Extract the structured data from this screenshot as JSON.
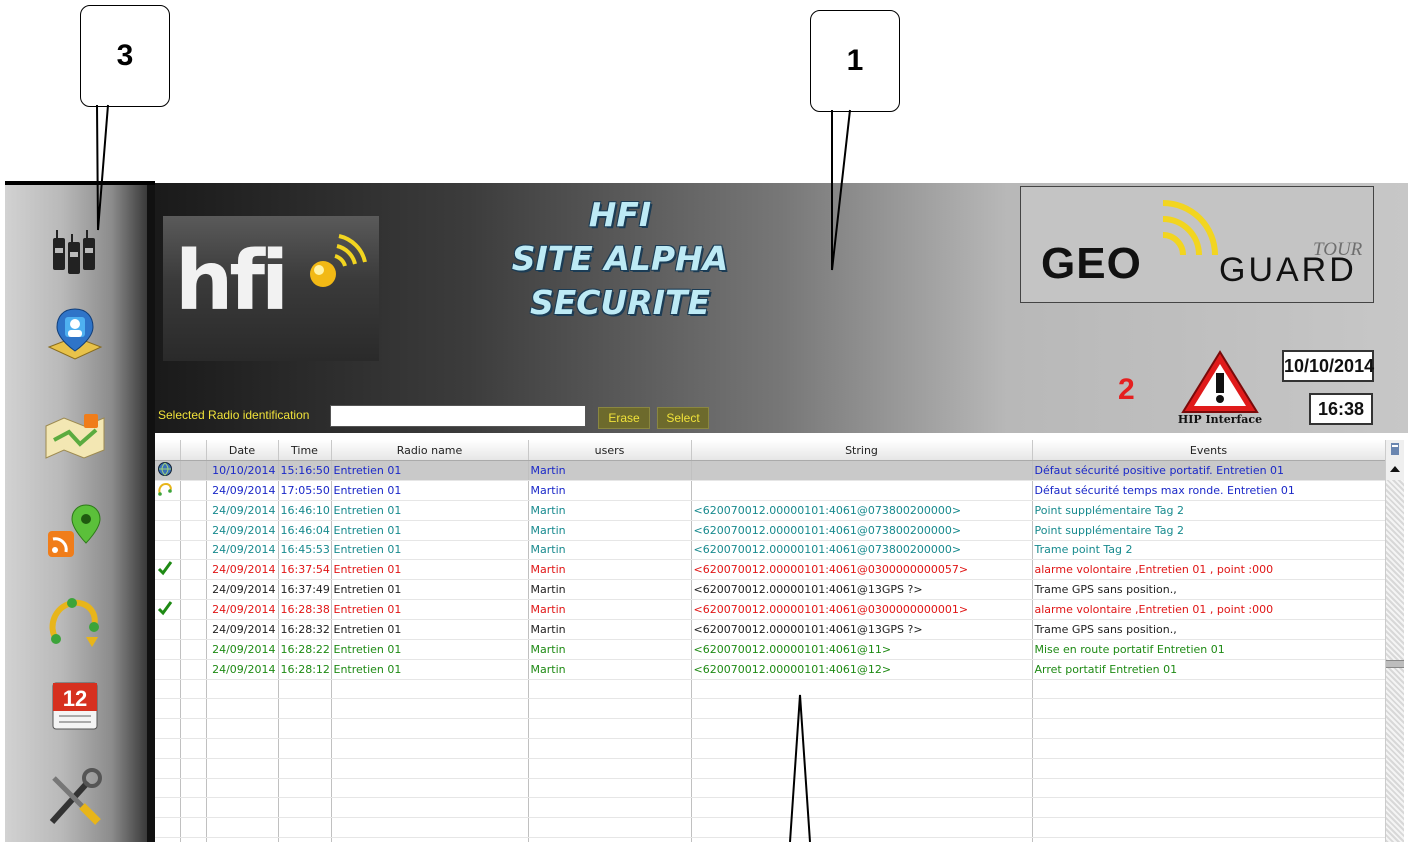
{
  "callouts": {
    "c1": "1",
    "c2": "2",
    "c3": "3"
  },
  "header": {
    "title_lines": [
      "HFI",
      "SITE ALPHA",
      "SECURITE"
    ],
    "hfi_logo_text": "hfi",
    "geoguard": {
      "geo": "GEO",
      "guard": "GUARD",
      "tour": "TOUR"
    },
    "selected_radio_label": "Selected Radio identification",
    "selected_radio_value": "",
    "erase_label": "Erase",
    "select_label": "Select",
    "hip_label": "HIP Interface",
    "date": "10/10/2014",
    "time": "16:38"
  },
  "sidebar": {
    "items": [
      {
        "icon": "radios-icon"
      },
      {
        "icon": "user-map-icon"
      },
      {
        "icon": "map-feed-icon"
      },
      {
        "icon": "rss-pin-icon"
      },
      {
        "icon": "route-icon"
      },
      {
        "icon": "calendar-icon",
        "text": "12"
      },
      {
        "icon": "tools-icon"
      }
    ]
  },
  "table": {
    "columns": [
      "",
      "",
      "Date",
      "Time",
      "Radio name",
      "users",
      "String",
      "Events"
    ],
    "rows": [
      {
        "icon": "globe",
        "date": "10/10/2014",
        "time": "15:16:50",
        "radio": "Entretien 01",
        "user": "Martin",
        "string": "",
        "event": "Défaut sécurité positive portatif.  Entretien 01",
        "color": "blue",
        "selected": true
      },
      {
        "icon": "route",
        "date": "24/09/2014",
        "time": "17:05:50",
        "radio": "Entretien 01",
        "user": "Martin",
        "string": "",
        "event": "Défaut sécurité temps max ronde.  Entretien 01",
        "color": "blue"
      },
      {
        "icon": "",
        "date": "24/09/2014",
        "time": "16:46:10",
        "radio": "Entretien 01",
        "user": "Martin",
        "string": "<620070012.00000101:4061@073800200000>",
        "event": "Point supplémentaire  Tag 2",
        "color": "teal"
      },
      {
        "icon": "",
        "date": "24/09/2014",
        "time": "16:46:04",
        "radio": "Entretien 01",
        "user": "Martin",
        "string": "<620070012.00000101:4061@073800200000>",
        "event": "Point supplémentaire  Tag 2",
        "color": "teal"
      },
      {
        "icon": "",
        "date": "24/09/2014",
        "time": "16:45:53",
        "radio": "Entretien 01",
        "user": "Martin",
        "string": "<620070012.00000101:4061@073800200000>",
        "event": "Trame point   Tag 2",
        "color": "teal"
      },
      {
        "icon": "check",
        "date": "24/09/2014",
        "time": "16:37:54",
        "radio": "Entretien 01",
        "user": "Martin",
        "string": "<620070012.00000101:4061@0300000000057>",
        "event": "alarme volontaire  ,Entretien 01   , point :000",
        "color": "red"
      },
      {
        "icon": "",
        "date": "24/09/2014",
        "time": "16:37:49",
        "radio": "Entretien 01",
        "user": "Martin",
        "string": "<620070012.00000101:4061@13GPS ?>",
        "event": "Trame GPS  sans position.,",
        "color": "dark"
      },
      {
        "icon": "check",
        "date": "24/09/2014",
        "time": "16:28:38",
        "radio": "Entretien 01",
        "user": "Martin",
        "string": "<620070012.00000101:4061@0300000000001>",
        "event": "alarme volontaire  ,Entretien 01   , point :000",
        "color": "red"
      },
      {
        "icon": "",
        "date": "24/09/2014",
        "time": "16:28:32",
        "radio": "Entretien 01",
        "user": "Martin",
        "string": "<620070012.00000101:4061@13GPS ?>",
        "event": "Trame GPS  sans position.,",
        "color": "dark"
      },
      {
        "icon": "",
        "date": "24/09/2014",
        "time": "16:28:22",
        "radio": "Entretien 01",
        "user": "Martin",
        "string": "<620070012.00000101:4061@11>",
        "event": "Mise en route portatif  Entretien 01",
        "color": "green"
      },
      {
        "icon": "",
        "date": "24/09/2014",
        "time": "16:28:12",
        "radio": "Entretien 01",
        "user": "Martin",
        "string": "<620070012.00000101:4061@12>",
        "event": "Arret portatif  Entretien 01",
        "color": "green"
      }
    ],
    "empty_rows": 9
  },
  "colors": {
    "blue": "#1a28c8",
    "teal": "#178a8e",
    "red": "#e01515",
    "dark": "#222222",
    "green": "#1e8a14",
    "callout_red": "#e52020"
  }
}
